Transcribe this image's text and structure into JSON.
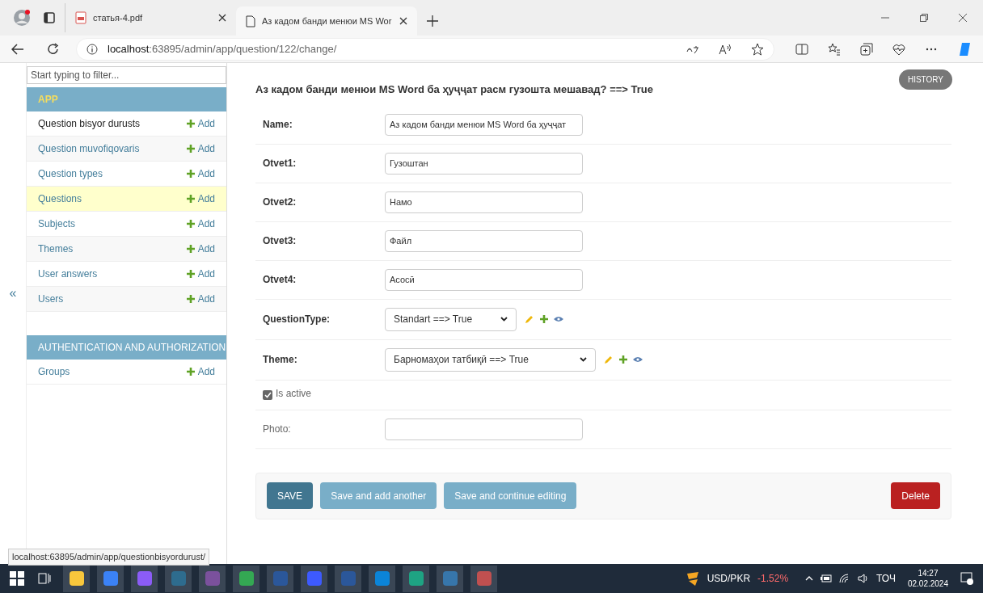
{
  "browser": {
    "tabs": [
      {
        "title": "статья-4.pdf",
        "kind": "pdf",
        "selected": false
      },
      {
        "title": "Аз кадом банди менюи MS Wor",
        "kind": "page",
        "selected": true
      }
    ],
    "url_host": "localhost",
    "url_rest": ":63895/admin/app/question/122/change/"
  },
  "sidebar": {
    "filter_placeholder": "Start typing to filter...",
    "collapse": "«",
    "modules": [
      {
        "title": "APP",
        "models": [
          {
            "name": "Question bisyor durusts",
            "add": "Add",
            "selected": false,
            "hovered": true
          },
          {
            "name": "Question muvofiqovaris",
            "add": "Add",
            "selected": false,
            "hovered": false
          },
          {
            "name": "Question types",
            "add": "Add",
            "selected": false,
            "hovered": false
          },
          {
            "name": "Questions",
            "add": "Add",
            "selected": true,
            "hovered": false
          },
          {
            "name": "Subjects",
            "add": "Add",
            "selected": false,
            "hovered": false
          },
          {
            "name": "Themes",
            "add": "Add",
            "selected": false,
            "hovered": false
          },
          {
            "name": "User answers",
            "add": "Add",
            "selected": false,
            "hovered": false
          },
          {
            "name": "Users",
            "add": "Add",
            "selected": false,
            "hovered": false
          }
        ]
      },
      {
        "title": "AUTHENTICATION AND AUTHORIZATION",
        "models": [
          {
            "name": "Groups",
            "add": "Add",
            "selected": false,
            "hovered": false
          }
        ]
      }
    ]
  },
  "main": {
    "history": "HISTORY",
    "heading": "Аз кадом банди менюи MS Word ба ҳуҷҷат расм гузошта мешавад? ==> True",
    "fields": [
      {
        "kind": "text",
        "label": "Name:",
        "required": true,
        "value": "Аз кадом банди менюи MS Word ба ҳуҷҷат"
      },
      {
        "kind": "text",
        "label": "Otvet1:",
        "required": true,
        "value": "Гузоштан"
      },
      {
        "kind": "text",
        "label": "Otvet2:",
        "required": true,
        "value": "Намо"
      },
      {
        "kind": "text",
        "label": "Otvet3:",
        "required": true,
        "value": "Файл"
      },
      {
        "kind": "text",
        "label": "Otvet4:",
        "required": true,
        "value": "Асосӣ"
      },
      {
        "kind": "select",
        "label": "QuestionType:",
        "required": true,
        "value": "Standart ==> True",
        "wide": false
      },
      {
        "kind": "select",
        "label": "Theme:",
        "required": true,
        "value": "Барномаҳои татбиқӣ ==> True",
        "wide": true
      },
      {
        "kind": "checkbox",
        "label": "Is active",
        "checked": true
      },
      {
        "kind": "file",
        "label": "Photo:",
        "required": false
      }
    ],
    "buttons": [
      {
        "kind": "primary",
        "label": "SAVE"
      },
      {
        "kind": "secondary",
        "label": "Save and add another"
      },
      {
        "kind": "secondary",
        "label": "Save and continue editing"
      },
      {
        "kind": "danger",
        "label": "Delete"
      }
    ]
  },
  "status_url": "localhost:63895/admin/app/questionbisyordurust/",
  "taskbar": {
    "ticker": "USD/PKR",
    "change": "-1.52%",
    "language": "ТОЧ",
    "time": "14:27",
    "date": "02.02.2024"
  }
}
